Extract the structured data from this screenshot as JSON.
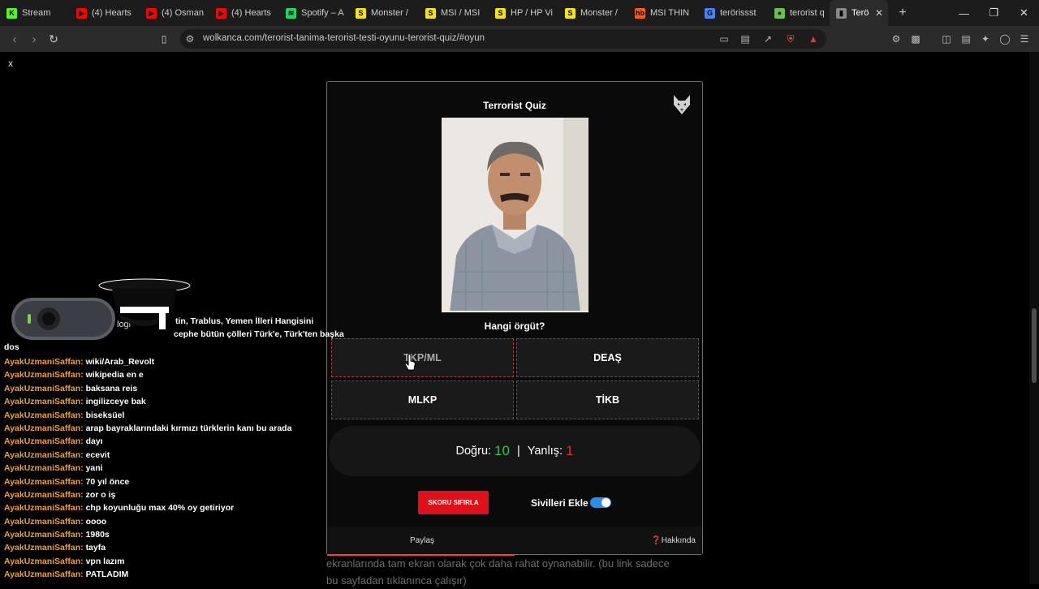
{
  "tabs": [
    {
      "title": "Stream",
      "icon": "kick-icon",
      "color": "#53fc18"
    },
    {
      "title": "(4) Hearts",
      "icon": "youtube-icon",
      "color": "#ff0000"
    },
    {
      "title": "(4) Osman",
      "icon": "youtube-icon",
      "color": "#ff0000"
    },
    {
      "title": "(4) Hearts",
      "icon": "youtube-icon",
      "color": "#ff0000"
    },
    {
      "title": "Spotify – A",
      "icon": "spotify-icon",
      "color": "#1ed760"
    },
    {
      "title": "Monster /",
      "icon": "s-letter-icon",
      "color": "#f5e50a"
    },
    {
      "title": "MSI / MSI",
      "icon": "s-letter-icon",
      "color": "#f5e50a"
    },
    {
      "title": "HP / HP Vi",
      "icon": "s-letter-icon",
      "color": "#f5e50a"
    },
    {
      "title": "Monster /",
      "icon": "s-letter-icon",
      "color": "#f5e50a"
    },
    {
      "title": "MSI THIN",
      "icon": "hb-icon",
      "color": "#ff6000"
    },
    {
      "title": "terörissst",
      "icon": "google-icon",
      "color": "#4285f4"
    },
    {
      "title": "terorist qu",
      "icon": "leaf-icon",
      "color": "#6cc04a"
    },
    {
      "title": "Terör",
      "icon": "page-icon",
      "color": "#888888"
    }
  ],
  "address_bar": {
    "url": "wolkanca.com/terorist-tanima-terorist-testi-oyunu-terorist-quiz/#oyun"
  },
  "page": {
    "close_label": "x"
  },
  "quiz": {
    "title": "Terrorist Quiz",
    "question": "Hangi örgüt?",
    "answers": [
      "TKP/ML",
      "DEAŞ",
      "MLKP",
      "TİKB"
    ],
    "score": {
      "correct_label": "Doğru:",
      "correct": "10",
      "separator": "|",
      "wrong_label": "Yanlış:",
      "wrong": "1"
    },
    "reset_label": "SKORU SIFIRLA",
    "civilians_label": "Sivilleri Ekle",
    "civilians_enabled": true,
    "share_label": "Paylaş",
    "about_icon": "❓",
    "about_label": "Hakkında",
    "progress_fraction": 0.5
  },
  "below_text": "ekranlarında tam ekran olarak çok daha rahat oynanabilir. (bu link sadece bu sayfadan tıklanınca çalışır)",
  "chat": {
    "partial_lines": [
      "tin, Trablus, Yemen İlleri Hangisini",
      "cephe bütün çölleri Türk'e, Türk'ten başka",
      "dos"
    ],
    "webcam_logo": "logi",
    "messages": [
      {
        "user": "AyakUzmaniSaffan:",
        "text": "wiki/Arab_Revolt"
      },
      {
        "user": "AyakUzmaniSaffan:",
        "text": "wikipedia en e"
      },
      {
        "user": "AyakUzmaniSaffan:",
        "text": "baksana reis"
      },
      {
        "user": "AyakUzmaniSaffan:",
        "text": "ingilizceye bak"
      },
      {
        "user": "AyakUzmaniSaffan:",
        "text": "biseksüel"
      },
      {
        "user": "AyakUzmaniSaffan:",
        "text": "arap bayraklarındaki kırmızı türklerin kanı bu arada"
      },
      {
        "user": "AyakUzmaniSaffan:",
        "text": "dayı"
      },
      {
        "user": "AyakUzmaniSaffan:",
        "text": "ecevit"
      },
      {
        "user": "AyakUzmaniSaffan:",
        "text": "yani"
      },
      {
        "user": "AyakUzmaniSaffan:",
        "text": "70 yıl önce"
      },
      {
        "user": "AyakUzmaniSaffan:",
        "text": "zor o iş"
      },
      {
        "user": "AyakUzmaniSaffan:",
        "text": "chp koyunluğu max 40% oy getiriyor"
      },
      {
        "user": "AyakUzmaniSaffan:",
        "text": "oooo"
      },
      {
        "user": "AyakUzmaniSaffan:",
        "text": "1980s"
      },
      {
        "user": "AyakUzmaniSaffan:",
        "text": "tayfa"
      },
      {
        "user": "AyakUzmaniSaffan:",
        "text": "vpn lazım"
      },
      {
        "user": "AyakUzmaniSaffan:",
        "text": "PATLADIM"
      }
    ]
  }
}
